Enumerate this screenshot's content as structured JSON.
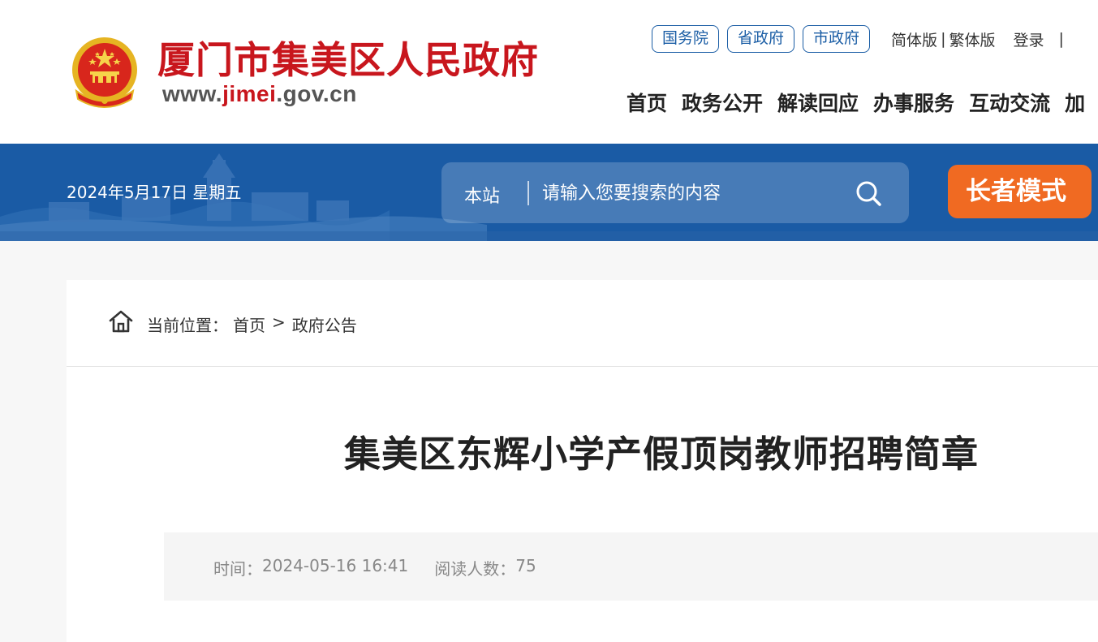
{
  "header": {
    "site_name": "厦门市集美区人民政府",
    "site_url_prefix": "www.",
    "site_url_highlight": "jimei",
    "site_url_suffix": ".gov.cn",
    "gov_links": [
      "国务院",
      "省政府",
      "市政府"
    ],
    "lang_simplified": "简体版",
    "lang_separator": "|",
    "lang_traditional": "繁体版",
    "login": "登录",
    "trailing_bar": "|",
    "nav": [
      "首页",
      "政务公开",
      "解读回应",
      "办事服务",
      "互动交流",
      "加"
    ]
  },
  "banner": {
    "date": "2024年5月17日 星期五",
    "search_scope": "本站",
    "search_placeholder": "请输入您要搜索的内容",
    "elder_mode": "长者模式"
  },
  "breadcrumb": {
    "label": "当前位置：",
    "home": "首页",
    "separator": ">",
    "current": "政府公告"
  },
  "article": {
    "title": "集美区东辉小学产假顶岗教师招聘简章",
    "time_label": "时间：",
    "time_value": "2024-05-16 16:41",
    "reads_label": "阅读人数：",
    "reads_value": "75"
  },
  "colors": {
    "brand_red": "#c8161d",
    "link_blue": "#1a5da5",
    "banner_blue": "#1a5ba5",
    "elder_orange": "#f06a22"
  },
  "icons": {
    "emblem": "national-emblem-icon",
    "search": "search-icon",
    "home": "home-icon"
  }
}
